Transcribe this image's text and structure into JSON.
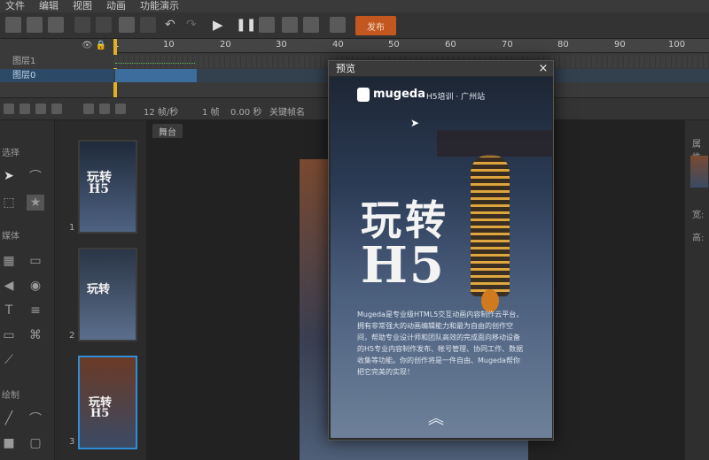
{
  "menu": [
    "文件",
    "编辑",
    "视图",
    "动画",
    "功能演示"
  ],
  "toolbar": {
    "publish_label": "发布"
  },
  "timeline": {
    "ticks": [
      "1",
      "10",
      "20",
      "30",
      "40",
      "50",
      "60",
      "70",
      "80",
      "90",
      "100"
    ],
    "layers": [
      {
        "name": "图层1"
      },
      {
        "name": "图层0"
      }
    ],
    "fps": "12 帧/秒",
    "frame": "1 帧",
    "time": "0.00 秒",
    "keyframe_label": "关键帧名"
  },
  "tools": {
    "select": "选择",
    "media": "媒体",
    "draw": "绘制"
  },
  "thumbs": [
    {
      "num": "1"
    },
    {
      "num": "2"
    },
    {
      "num": "3"
    }
  ],
  "stage_tab": "舞台",
  "props": {
    "title": "属性",
    "w": "宽:",
    "h": "高:"
  },
  "preview": {
    "title": "预览",
    "close": "×",
    "brand": "mugeda",
    "brand_sub": "H5培训 · 广州站",
    "headline1": "玩转",
    "headline2": "H5",
    "body": "Mugeda是专业级HTML5交互动画内容制作云平台，拥有非常强大的动画编辑能力和最为自由的创作空间，帮助专业设计师和团队高效的完成面向移动设备的H5专业内容制作发布、帐号管理、协同工作、数据收集等功能。你的创作将是一件自由、Mugeda帮你把它完美的实现！"
  },
  "colors": {
    "publish": "#c2571f",
    "selected": "#2f8ed6",
    "lantern": "#f0b03a"
  }
}
